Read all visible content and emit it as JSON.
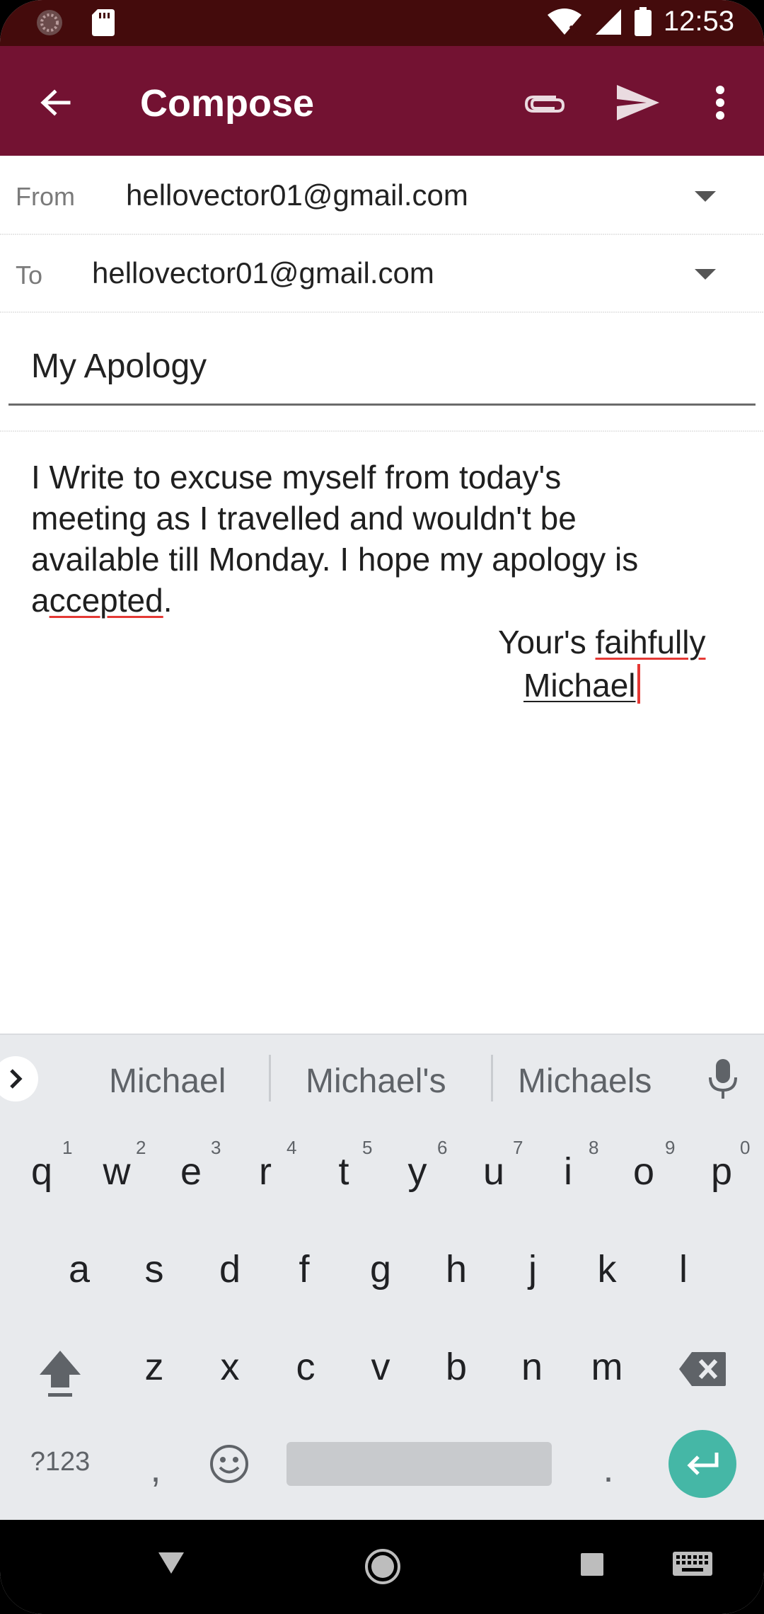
{
  "status_bar": {
    "time": "12:53"
  },
  "app_bar": {
    "title": "Compose"
  },
  "from": {
    "label": "From",
    "value": "hellovector01@gmail.com"
  },
  "to": {
    "label": "To",
    "value": "hellovector01@gmail.com"
  },
  "subject": {
    "value": "My Apology"
  },
  "body": {
    "line1_before": "I Write to excuse myself from today's",
    "line2": "meeting as I travelled and wouldn't be",
    "line3": "available till Monday. I hope my apology is",
    "line4_a": "a",
    "line4_misspelled": "ccepted",
    "line4_end": ".",
    "sig_prefix": "Your's ",
    "sig_misspelled": "faihfully",
    "sig_name": "Michael"
  },
  "suggestions": [
    "Michael",
    "Michael's",
    "Michaels"
  ],
  "keyboard": {
    "row1": [
      "q",
      "w",
      "e",
      "r",
      "t",
      "y",
      "u",
      "i",
      "o",
      "p"
    ],
    "row1_hints": [
      "1",
      "2",
      "3",
      "4",
      "5",
      "6",
      "7",
      "8",
      "9",
      "0"
    ],
    "row2": [
      "a",
      "s",
      "d",
      "f",
      "g",
      "h",
      "j",
      "k",
      "l"
    ],
    "row3": [
      "z",
      "x",
      "c",
      "v",
      "b",
      "n",
      "m"
    ],
    "symbols_key": "?123",
    "comma_key": ",",
    "period_key": "."
  },
  "colors": {
    "app_bar": "#731232",
    "status_bar": "#440b0c",
    "enter": "#45b7a6",
    "spell_underline": "#e53935"
  }
}
